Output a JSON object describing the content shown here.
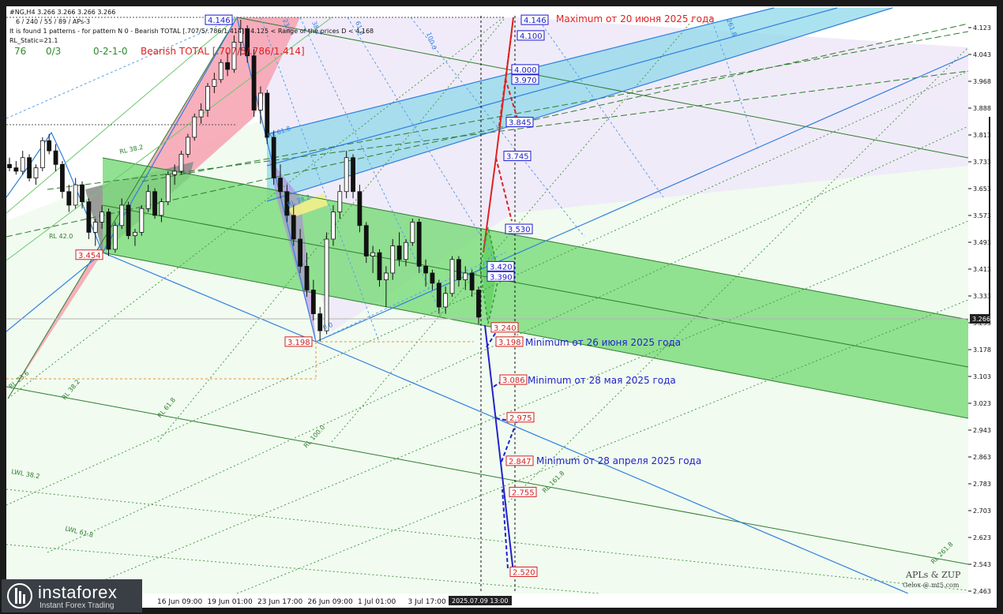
{
  "header": {
    "symbol_line": "#NG,H4  3.266 3.266 3.266 3.266",
    "indicator_params": "6 / 240 / 55 / 89 / APs-3",
    "pattern_info": "It is found 1 patterns  -  for pattern N 0 - Bearish TOTAL [.707/5/.786/1.414] - 4.125 < Range of the prices D < 4.168",
    "rl_static": "RL_Static=21.1",
    "counter_a": "76",
    "counter_b": "0/3",
    "counter_c": "0-2-1-0",
    "pattern_name": "Bearish TOTAL [.707/5/.786/1.414]"
  },
  "price_axis": {
    "ticks": [
      "4.123",
      "4.043",
      "3.968",
      "3.888",
      "3.813",
      "3.733",
      "3.653",
      "3.573",
      "3.493",
      "3.413",
      "3.333",
      "3.253",
      "3.178",
      "3.103",
      "3.023",
      "2.943",
      "2.863",
      "2.783",
      "2.703",
      "2.623",
      "2.543",
      "2.463"
    ],
    "current_price": "3.266"
  },
  "time_axis": {
    "ticks": [
      "16 Jun 09:00",
      "19 Jun 01:00",
      "23 Jun 17:00",
      "26 Jun 09:00",
      "1 Jul 01:00",
      "3 Jul 17:00"
    ],
    "highlight": "2025.07.09 13:00"
  },
  "price_labels": {
    "blue": [
      "4.146",
      "4.100",
      "4.000",
      "3.970",
      "3.845",
      "3.745",
      "3.530",
      "3.420",
      "3.390"
    ],
    "red": [
      "3.240",
      "3.198",
      "3.086",
      "2.975",
      "2.847",
      "2.755",
      "2.520"
    ],
    "pattern_points": [
      "4.146",
      "3.454",
      "3.198"
    ]
  },
  "annotations": {
    "max_june": "Maximum от 20 июня 2025 года",
    "min_june": "Minimum от 26 июня 2025 года",
    "min_may": "Minimum от 28 мая 2025 года",
    "min_april": "Minimum от 28 апреля 2025 года"
  },
  "line_labels": {
    "rl_382_top": "RL 38.2",
    "rl_42": "RL 42.0",
    "rl_236": "RL 23.6",
    "rl_382": "RL 38.2",
    "rl_618": "RL 61.8",
    "rl_1000": "RL 100.0",
    "rl_1618": "RL 161.8",
    "rl_2618": "RL 261.8",
    "lwl_382": "LWL 38.2",
    "lwl_618": "LWL 61.8",
    "blue_618": "RL 61.8",
    "blue_382": "RL 38.2",
    "blue_0": "0.0",
    "top_1000": "100.0",
    "top_618": "61.8",
    "top_382": "38.2",
    "top_236": "23.6",
    "top_2618": "261.8"
  },
  "watermark": {
    "line1": "APLs & ZUP",
    "line2": "Gelox @ mt5.com"
  },
  "logo": {
    "brand": "instaforex",
    "tagline": "Instant Forex Trading"
  },
  "colors": {
    "bear_red": "#dd2222",
    "bull_blue": "#2222cc",
    "channel_green": "#7fdc7f",
    "zone_pink": "#f7a1b0",
    "zone_cyan": "#8fd8ea",
    "zone_lavender": "#ece6f7",
    "zigzag_blue": "#2f7fe0"
  },
  "chart_data": {
    "type": "candlestick",
    "title": "#NG,H4",
    "y_axis_range": [
      2.463,
      4.2
    ],
    "candles": [
      [
        3.72,
        3.74,
        3.7,
        3.71
      ],
      [
        3.71,
        3.73,
        3.69,
        3.7
      ],
      [
        3.7,
        3.76,
        3.69,
        3.74
      ],
      [
        3.74,
        3.75,
        3.67,
        3.68
      ],
      [
        3.68,
        3.72,
        3.66,
        3.71
      ],
      [
        3.71,
        3.8,
        3.7,
        3.79
      ],
      [
        3.79,
        3.81,
        3.75,
        3.76
      ],
      [
        3.76,
        3.78,
        3.7,
        3.72
      ],
      [
        3.72,
        3.73,
        3.62,
        3.64
      ],
      [
        3.64,
        3.66,
        3.58,
        3.6
      ],
      [
        3.6,
        3.68,
        3.59,
        3.66
      ],
      [
        3.66,
        3.67,
        3.59,
        3.61
      ],
      [
        3.61,
        3.62,
        3.5,
        3.52
      ],
      [
        3.52,
        3.56,
        3.48,
        3.55
      ],
      [
        3.55,
        3.6,
        3.53,
        3.58
      ],
      [
        3.58,
        3.59,
        3.45,
        3.47
      ],
      [
        3.47,
        3.55,
        3.46,
        3.54
      ],
      [
        3.54,
        3.62,
        3.53,
        3.6
      ],
      [
        3.6,
        3.61,
        3.5,
        3.51
      ],
      [
        3.51,
        3.53,
        3.48,
        3.52
      ],
      [
        3.52,
        3.6,
        3.51,
        3.59
      ],
      [
        3.59,
        3.66,
        3.58,
        3.64
      ],
      [
        3.64,
        3.65,
        3.56,
        3.57
      ],
      [
        3.57,
        3.62,
        3.55,
        3.61
      ],
      [
        3.61,
        3.7,
        3.6,
        3.69
      ],
      [
        3.69,
        3.72,
        3.66,
        3.7
      ],
      [
        3.7,
        3.76,
        3.69,
        3.75
      ],
      [
        3.75,
        3.81,
        3.74,
        3.8
      ],
      [
        3.8,
        3.87,
        3.79,
        3.86
      ],
      [
        3.86,
        3.9,
        3.84,
        3.88
      ],
      [
        3.88,
        3.96,
        3.86,
        3.95
      ],
      [
        3.95,
        3.99,
        3.93,
        3.97
      ],
      [
        3.97,
        4.03,
        3.96,
        4.02
      ],
      [
        4.02,
        4.05,
        3.98,
        4.0
      ],
      [
        4.0,
        4.1,
        3.99,
        4.08
      ],
      [
        4.08,
        4.146,
        4.04,
        4.12
      ],
      [
        4.12,
        4.13,
        4.02,
        4.04
      ],
      [
        4.04,
        4.06,
        3.86,
        3.88
      ],
      [
        3.88,
        3.95,
        3.84,
        3.93
      ],
      [
        3.93,
        3.94,
        3.78,
        3.8
      ],
      [
        3.8,
        3.82,
        3.66,
        3.68
      ],
      [
        3.68,
        3.72,
        3.62,
        3.64
      ],
      [
        3.64,
        3.66,
        3.55,
        3.57
      ],
      [
        3.57,
        3.6,
        3.48,
        3.5
      ],
      [
        3.5,
        3.53,
        3.4,
        3.42
      ],
      [
        3.42,
        3.46,
        3.33,
        3.35
      ],
      [
        3.35,
        3.38,
        3.26,
        3.28
      ],
      [
        3.28,
        3.3,
        3.198,
        3.23
      ],
      [
        3.23,
        3.52,
        3.22,
        3.5
      ],
      [
        3.5,
        3.6,
        3.48,
        3.58
      ],
      [
        3.58,
        3.66,
        3.56,
        3.64
      ],
      [
        3.64,
        3.76,
        3.62,
        3.74
      ],
      [
        3.74,
        3.75,
        3.62,
        3.64
      ],
      [
        3.64,
        3.66,
        3.52,
        3.54
      ],
      [
        3.54,
        3.55,
        3.43,
        3.45
      ],
      [
        3.45,
        3.48,
        3.4,
        3.46
      ],
      [
        3.46,
        3.47,
        3.36,
        3.38
      ],
      [
        3.38,
        3.42,
        3.3,
        3.4
      ],
      [
        3.4,
        3.5,
        3.38,
        3.48
      ],
      [
        3.48,
        3.52,
        3.42,
        3.44
      ],
      [
        3.44,
        3.5,
        3.42,
        3.49
      ],
      [
        3.49,
        3.56,
        3.48,
        3.55
      ],
      [
        3.55,
        3.56,
        3.4,
        3.42
      ],
      [
        3.42,
        3.44,
        3.36,
        3.4
      ],
      [
        3.4,
        3.41,
        3.35,
        3.37
      ],
      [
        3.37,
        3.38,
        3.28,
        3.3
      ],
      [
        3.3,
        3.36,
        3.28,
        3.34
      ],
      [
        3.34,
        3.45,
        3.33,
        3.44
      ],
      [
        3.44,
        3.45,
        3.36,
        3.38
      ],
      [
        3.38,
        3.42,
        3.35,
        3.4
      ],
      [
        3.4,
        3.41,
        3.33,
        3.35
      ],
      [
        3.35,
        3.36,
        3.25,
        3.27
      ]
    ]
  }
}
